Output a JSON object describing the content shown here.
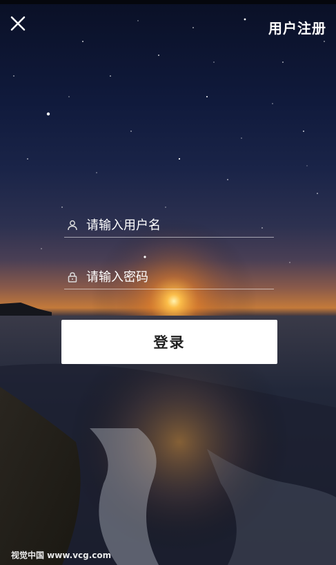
{
  "header": {
    "close_icon": "close-icon",
    "register_label": "用户注册"
  },
  "form": {
    "username": {
      "icon": "user-icon",
      "placeholder": "请输入用户名",
      "value": ""
    },
    "password": {
      "icon": "lock-icon",
      "placeholder": "请输入密码",
      "value": ""
    },
    "login_label": "登录"
  },
  "background": {
    "description_icon": "starry-sky-sunset-beach-image"
  },
  "watermark": "视觉中国 www.vcg.com",
  "colors": {
    "text": "#ffffff",
    "button_bg": "#ffffff",
    "button_text": "#222222"
  }
}
